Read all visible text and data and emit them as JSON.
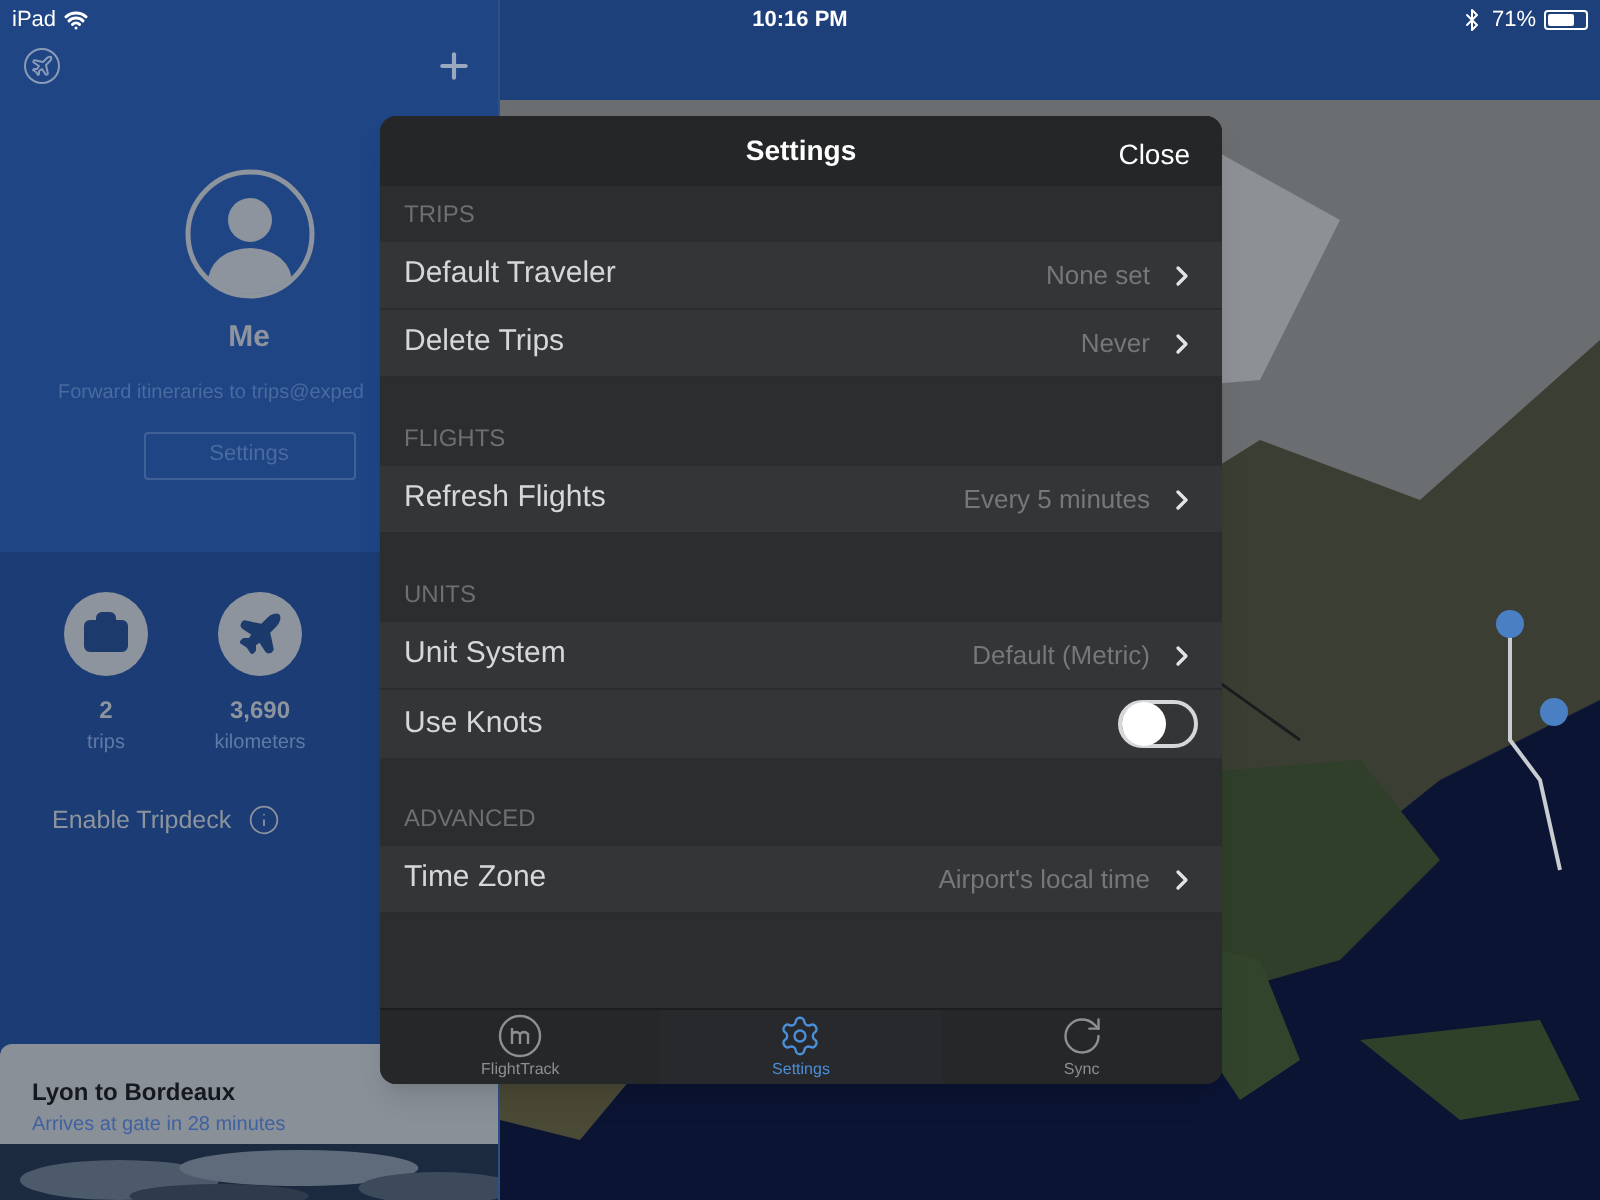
{
  "status_bar": {
    "device": "iPad",
    "time": "10:16 PM",
    "battery": "71%"
  },
  "sidebar": {
    "profile": {
      "name": "Me",
      "hint": "Forward itineraries to trips@exped",
      "button": "Settings"
    },
    "stats": [
      {
        "kind": "trips",
        "value": "2",
        "label": "trips"
      },
      {
        "kind": "distance",
        "value": "3,690",
        "label": "kilometers"
      }
    ],
    "tripdeck": {
      "label": "Enable Tripdeck"
    },
    "trip_card": {
      "title": "Lyon to Bordeaux",
      "status": "Arrives at gate in 28 minutes"
    }
  },
  "settings": {
    "title": "Settings",
    "close": "Close",
    "sections": [
      {
        "header": "TRIPS",
        "rows": [
          {
            "kind": "link",
            "label": "Default Traveler",
            "value": "None set"
          },
          {
            "kind": "link",
            "label": "Delete Trips",
            "value": "Never"
          }
        ]
      },
      {
        "header": "FLIGHTS",
        "rows": [
          {
            "kind": "link",
            "label": "Refresh Flights",
            "value": "Every 5 minutes"
          }
        ]
      },
      {
        "header": "UNITS",
        "rows": [
          {
            "kind": "link",
            "label": "Unit System",
            "value": "Default (Metric)"
          },
          {
            "kind": "toggle",
            "label": "Use Knots",
            "on": false
          }
        ]
      },
      {
        "header": "ADVANCED",
        "rows": [
          {
            "kind": "link",
            "label": "Time Zone",
            "value": "Airport's local time"
          }
        ]
      }
    ],
    "tabs": [
      {
        "kind": "flighttrack",
        "label": "FlightTrack",
        "selected": false
      },
      {
        "kind": "settings",
        "label": "Settings",
        "selected": true
      },
      {
        "kind": "sync",
        "label": "Sync",
        "selected": false
      }
    ]
  }
}
